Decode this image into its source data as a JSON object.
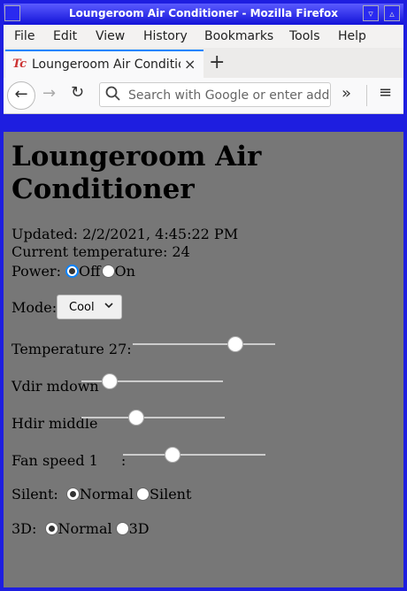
{
  "window": {
    "title": "Loungeroom Air Conditioner - Mozilla Firefox",
    "sys_left": "",
    "sys_min": "▿",
    "sys_max": "▵"
  },
  "menu": {
    "items": [
      "File",
      "Edit",
      "View",
      "History",
      "Bookmarks",
      "Tools",
      "Help"
    ]
  },
  "tab": {
    "favicon": "Tc",
    "title": "Loungeroom Air Conditio",
    "close": "×",
    "new_tab": "+"
  },
  "nav": {
    "back": "←",
    "forward": "→",
    "reload": "↻",
    "search_icon": "search-icon",
    "search_placeholder": "Search with Google or enter address",
    "overflow": "»",
    "menu": "≡"
  },
  "page": {
    "heading": "Loungeroom Air Conditioner",
    "updated": "Updated: 2/2/2021, 4:45:22 PM",
    "current_temp": "Current temperature: 24",
    "power_label": "Power:",
    "power_options": [
      "Off",
      "On"
    ],
    "power_selected": "Off",
    "mode_label": "Mode:",
    "mode_value": "Cool",
    "temperature_label": "Temperature 27:",
    "temperature_level": 0.72,
    "vdir_label": "Vdir mdown",
    "vdir_level": 0.2,
    "hdir_label": "Hdir middle",
    "hdir_level": 0.38,
    "fan_label": "Fan speed 1",
    "fan_suffix": ":",
    "fan_level": 0.35,
    "silent_label": "Silent:",
    "silent_options": [
      "Normal",
      "Silent"
    ],
    "silent_selected": "Normal",
    "threed_label": "3D:",
    "threed_options": [
      "Normal",
      "3D"
    ],
    "threed_selected": "Normal"
  }
}
